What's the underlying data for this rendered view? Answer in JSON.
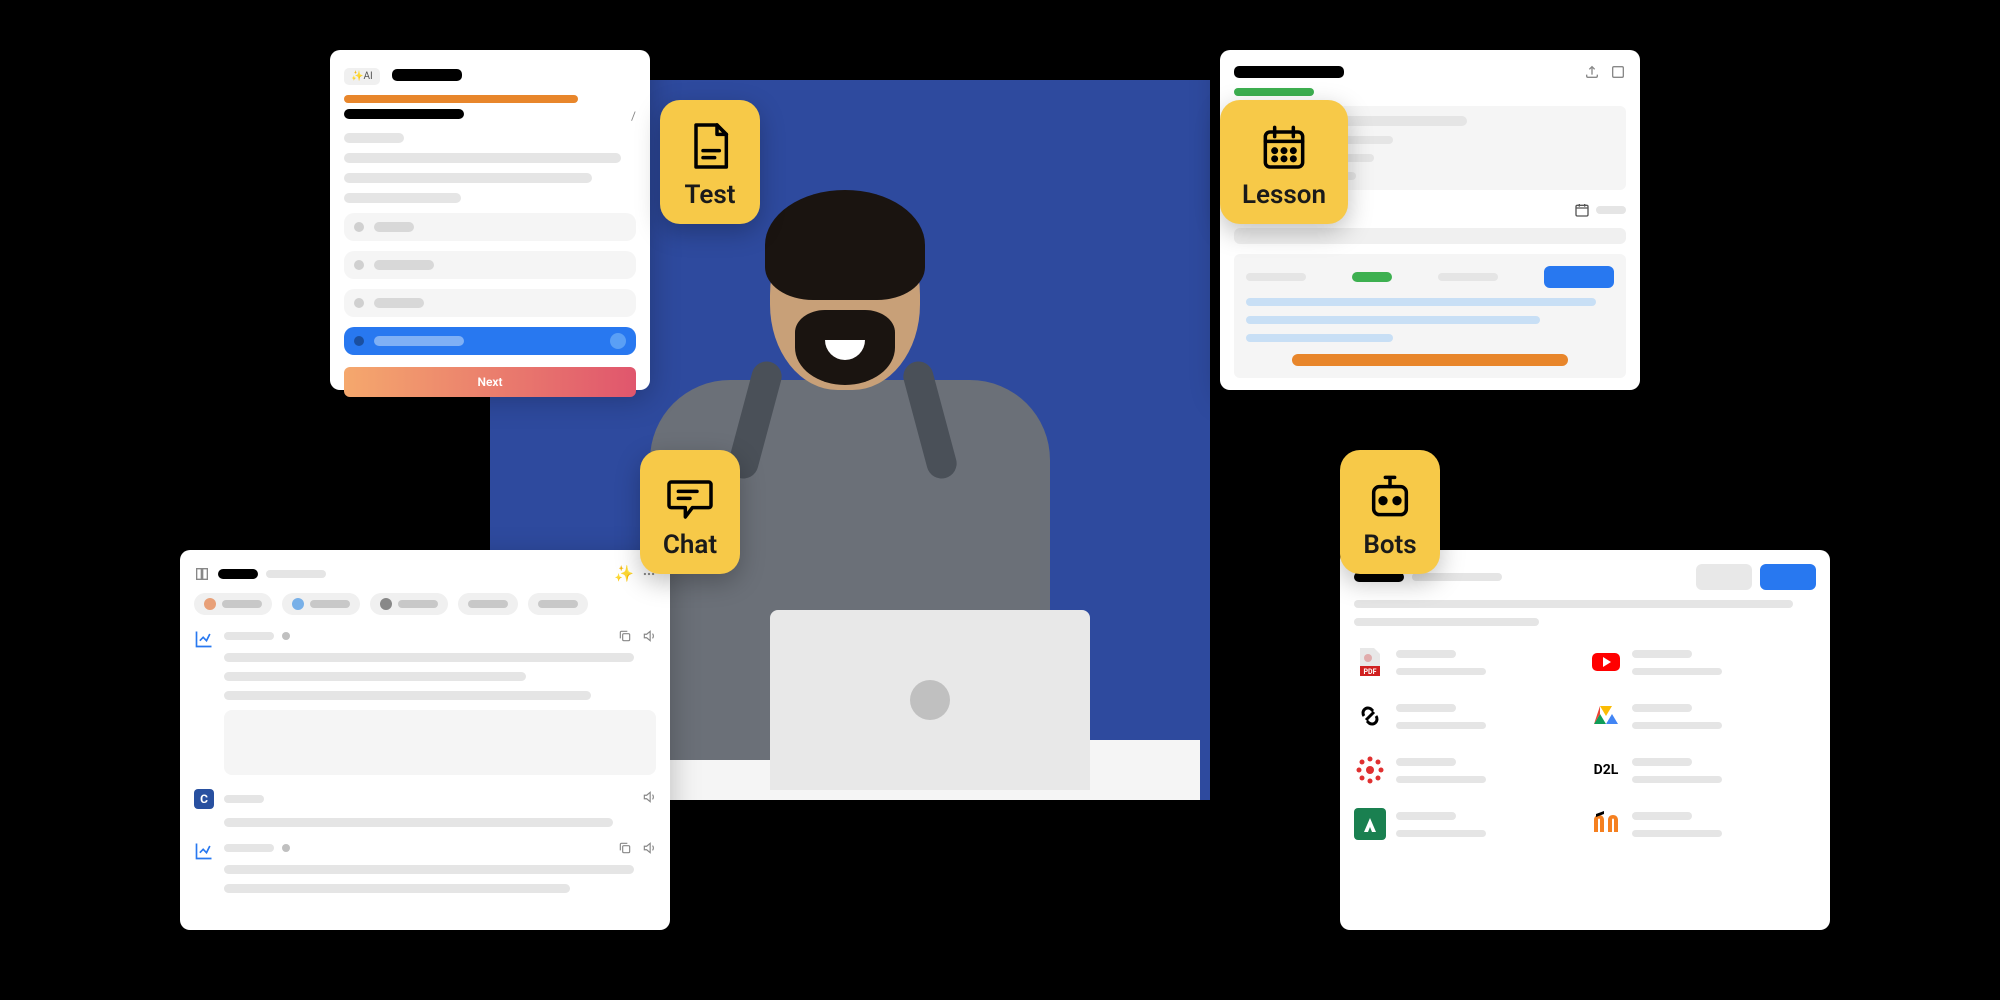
{
  "badges": {
    "test": "Test",
    "lesson": "Lesson",
    "chat": "Chat",
    "bots": "Bots"
  },
  "test_card": {
    "ai_label": "AI",
    "next_label": "Next"
  },
  "integrations": {
    "pdf": "PDF",
    "d2l": "D2L"
  }
}
